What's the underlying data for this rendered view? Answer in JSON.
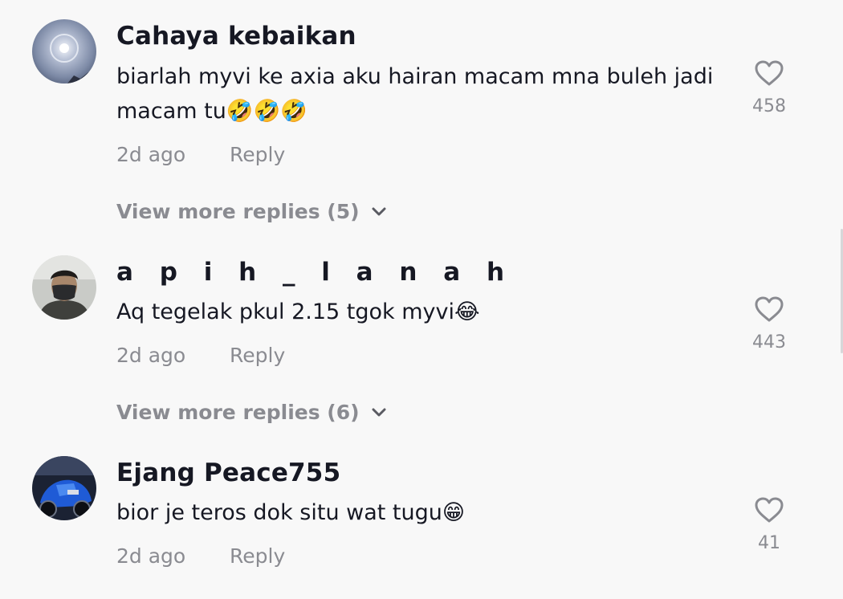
{
  "comments": [
    {
      "username": "Cahaya kebaikan",
      "text": "biarlah myvi ke axia aku hairan macam mna buleh jadi macam tu🤣🤣🤣",
      "time": "2d ago",
      "reply_label": "Reply",
      "likes": "458",
      "view_more": "View more replies (5)",
      "avatar_icon": "halo-sun-avatar-icon"
    },
    {
      "username": "a p i h _ l a n a h",
      "text": "Aq tegelak pkul 2.15 tgok myvi😂",
      "time": "2d ago",
      "reply_label": "Reply",
      "likes": "443",
      "view_more": "View more replies (6)",
      "avatar_icon": "masked-man-avatar-icon"
    },
    {
      "username": "Ejang Peace755",
      "text": "bior je teros dok situ wat tugu😁",
      "time": "2d ago",
      "reply_label": "Reply",
      "likes": "41",
      "avatar_icon": "blue-motorbike-avatar-icon"
    }
  ],
  "colors": {
    "background": "#f8f8f8",
    "primary_text": "#161823",
    "secondary_text": "#8a8b91"
  }
}
